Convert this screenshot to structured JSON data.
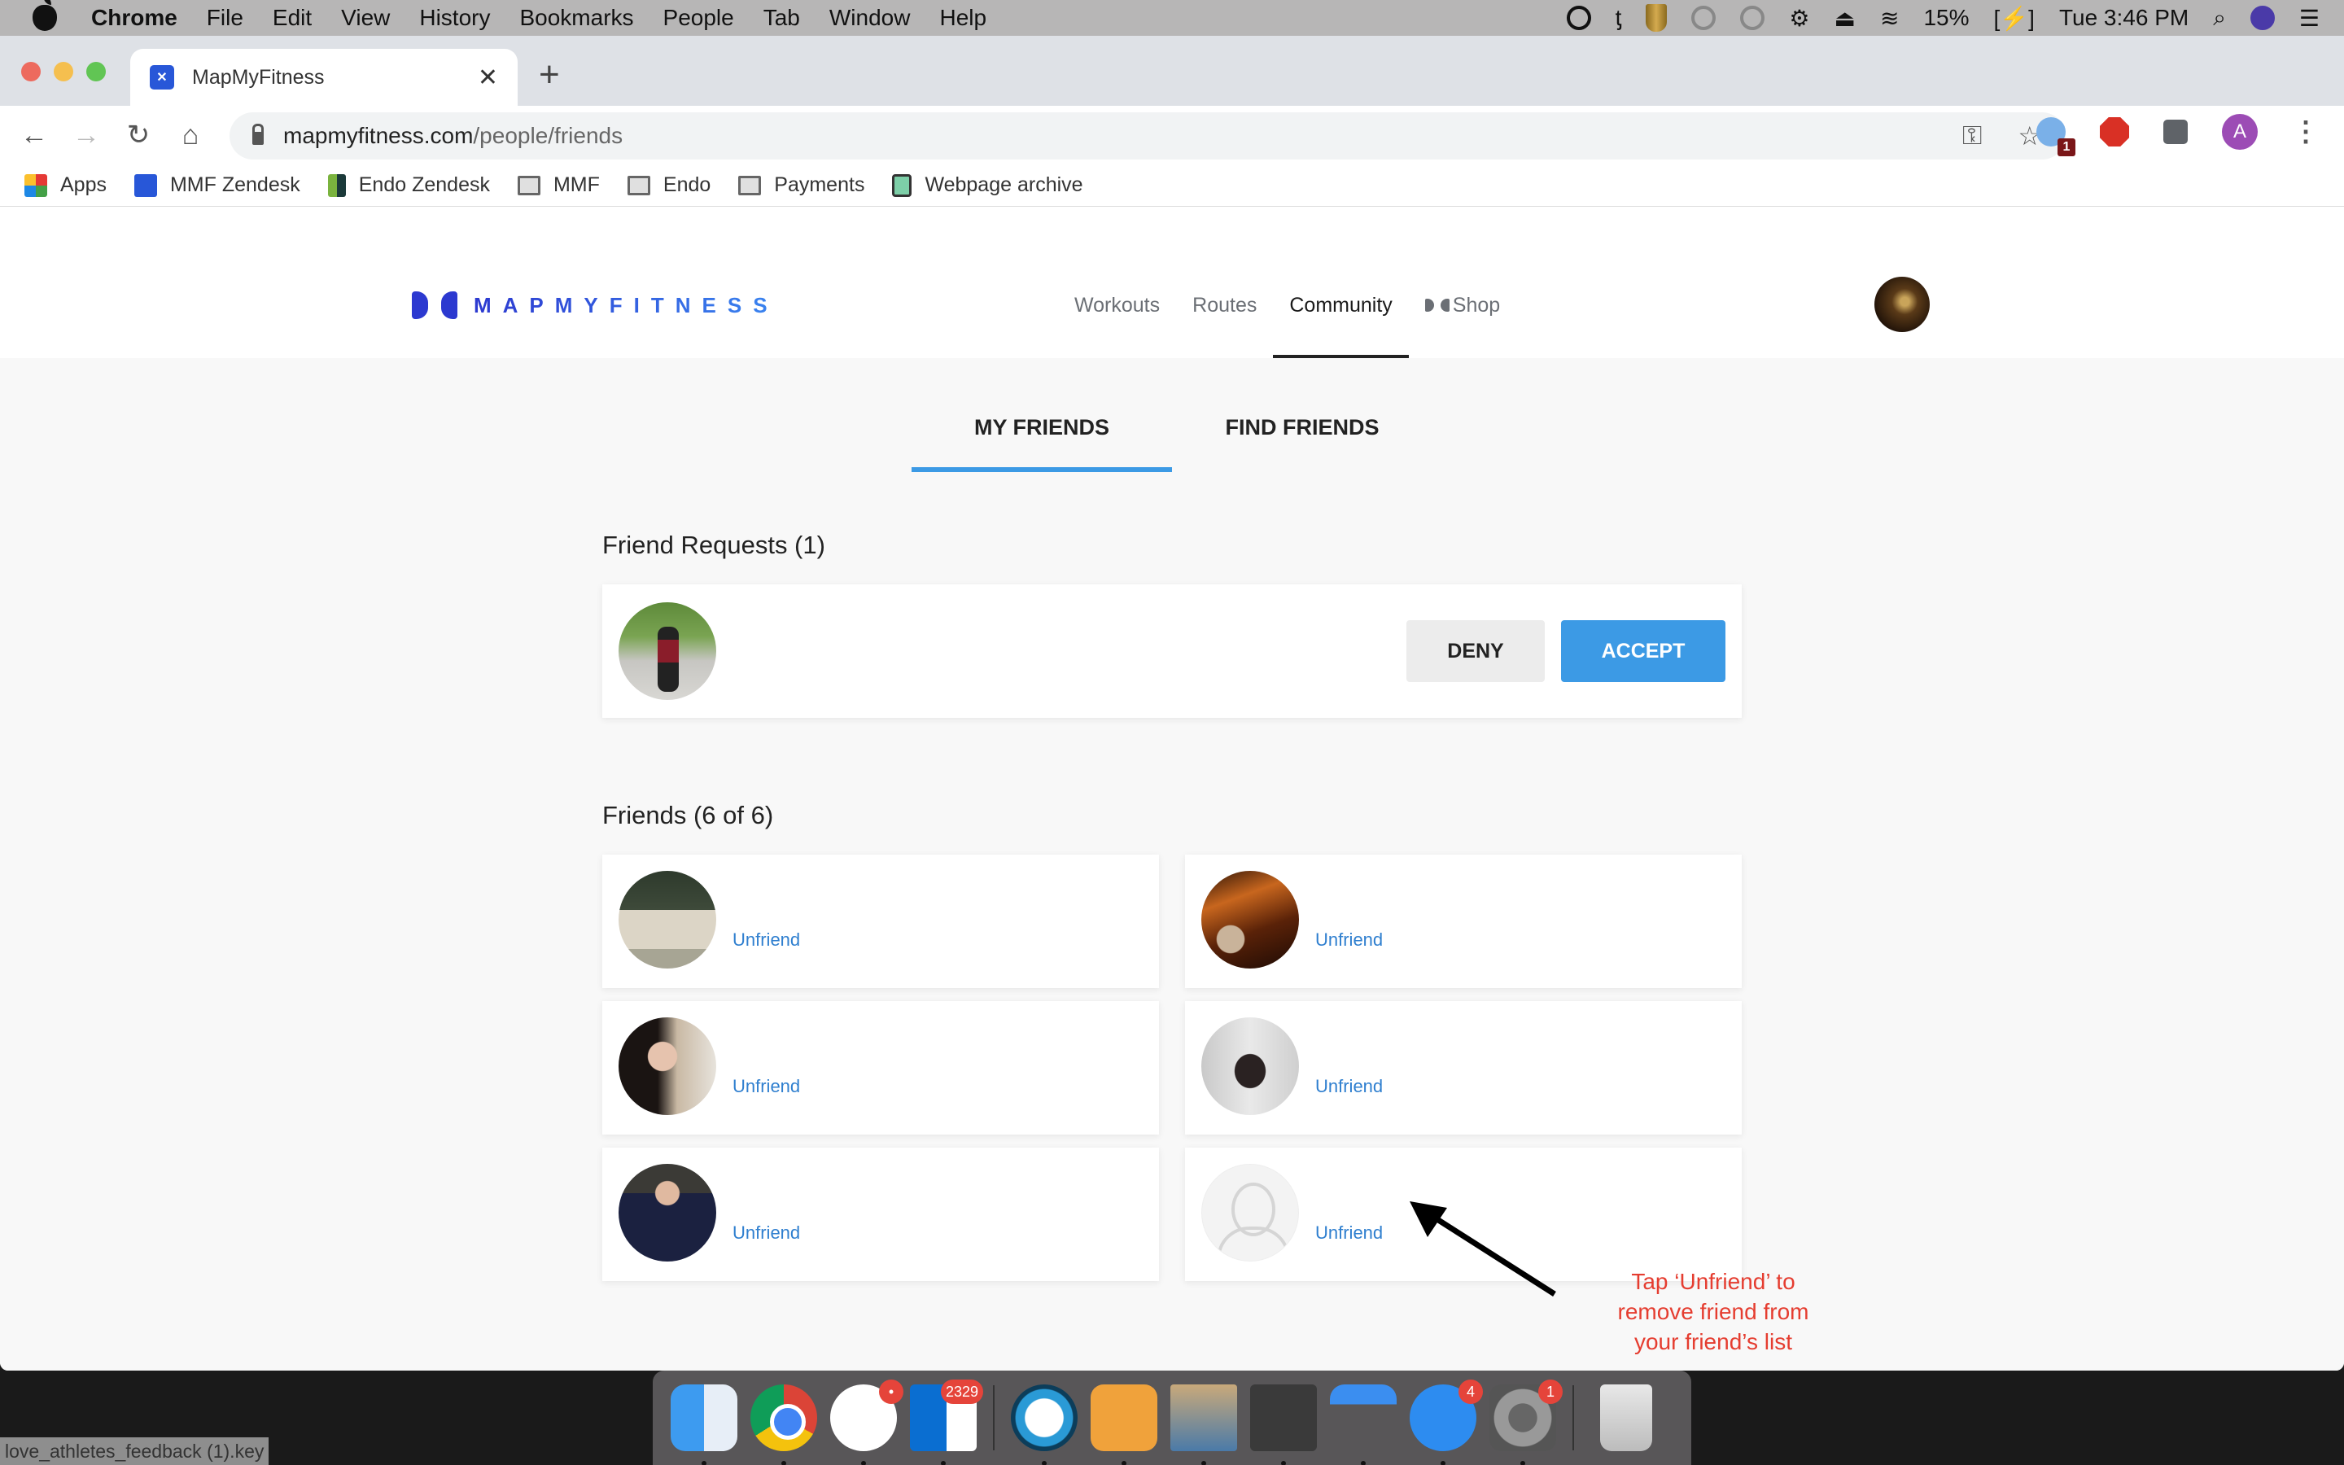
{
  "menubar": {
    "app": "Chrome",
    "items": [
      "File",
      "Edit",
      "View",
      "History",
      "Bookmarks",
      "People",
      "Tab",
      "Window",
      "Help"
    ],
    "battery": "15%",
    "clock": "Tue 3:46 PM"
  },
  "browser": {
    "tab_title": "MapMyFitness",
    "tab_favicon": "MMF",
    "url_domain": "mapmyfitness.com",
    "url_path": "/people/friends",
    "extension_badge": "1",
    "profile_initial": "A",
    "bookmarks": [
      "Apps",
      "MMF Zendesk",
      "Endo Zendesk",
      "MMF",
      "Endo",
      "Payments",
      "Webpage archive"
    ]
  },
  "site": {
    "logo_text": "MAPMYFITNESS",
    "nav": [
      "Workouts",
      "Routes",
      "Community",
      "Shop"
    ],
    "active_nav": "Community"
  },
  "friends_page": {
    "tabs": [
      "MY FRIENDS",
      "FIND FRIENDS"
    ],
    "active_tab": "MY FRIENDS",
    "requests_title": "Friend Requests (1)",
    "deny_label": "DENY",
    "accept_label": "ACCEPT",
    "friends_title": "Friends (6 of 6)",
    "unfriend_label": "Unfriend",
    "friends": [
      {
        "avatar": "dog-photo"
      },
      {
        "avatar": "woman-sunset-photo"
      },
      {
        "avatar": "woman-with-dog-photo"
      },
      {
        "avatar": "black-dog-photo"
      },
      {
        "avatar": "man-in-suit-photo"
      },
      {
        "avatar": "default-placeholder"
      }
    ]
  },
  "annotation": {
    "line1": "Tap ‘Unfriend’ to",
    "line2": "remove friend from",
    "line3": "your friend’s list",
    "color": "#e53d30"
  },
  "desktop": {
    "file_label": "love_athletes_feedback (1).key",
    "dock": [
      {
        "name": "Finder"
      },
      {
        "name": "Chrome"
      },
      {
        "name": "Slack",
        "badge": "•"
      },
      {
        "name": "Outlook",
        "badge": "2329"
      },
      {
        "name": "Webex"
      },
      {
        "name": "Tempo"
      },
      {
        "name": "Preview"
      },
      {
        "name": "Calculator"
      },
      {
        "name": "Keynote"
      },
      {
        "name": "App Store",
        "badge": "4"
      },
      {
        "name": "System Preferences",
        "badge": "1"
      },
      {
        "name": "Trash"
      }
    ]
  },
  "colors": {
    "accent": "#3c9ae5",
    "link": "#2f7fcf",
    "brand": "#2c39d0"
  }
}
